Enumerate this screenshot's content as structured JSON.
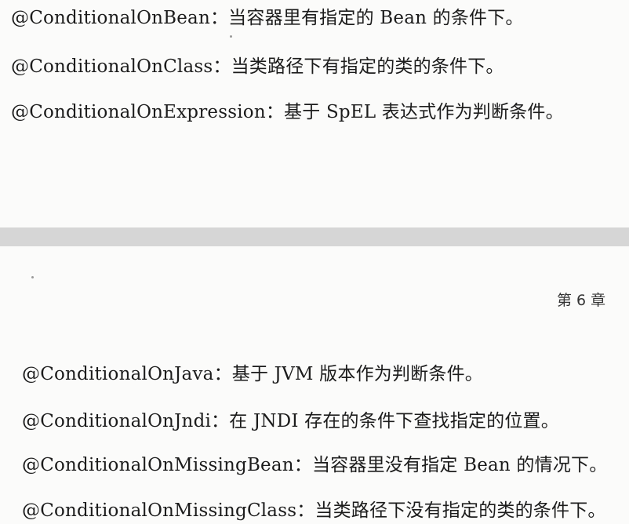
{
  "upper_page": {
    "lines": [
      "@ConditionalOnBean：当容器里有指定的 Bean 的条件下。",
      "@ConditionalOnClass：当类路径下有指定的类的条件下。",
      "@ConditionalOnExpression：基于 SpEL 表达式作为判断条件。"
    ]
  },
  "lower_page": {
    "chapter_label": "第 6 章",
    "lines": [
      "@ConditionalOnJava：基于 JVM 版本作为判断条件。",
      "@ConditionalOnJndi：在 JNDI 存在的条件下查找指定的位置。",
      "@ConditionalOnMissingBean：当容器里没有指定 Bean 的情况下。",
      "@ConditionalOnMissingClass：当类路径下没有指定的类的条件下。"
    ]
  }
}
